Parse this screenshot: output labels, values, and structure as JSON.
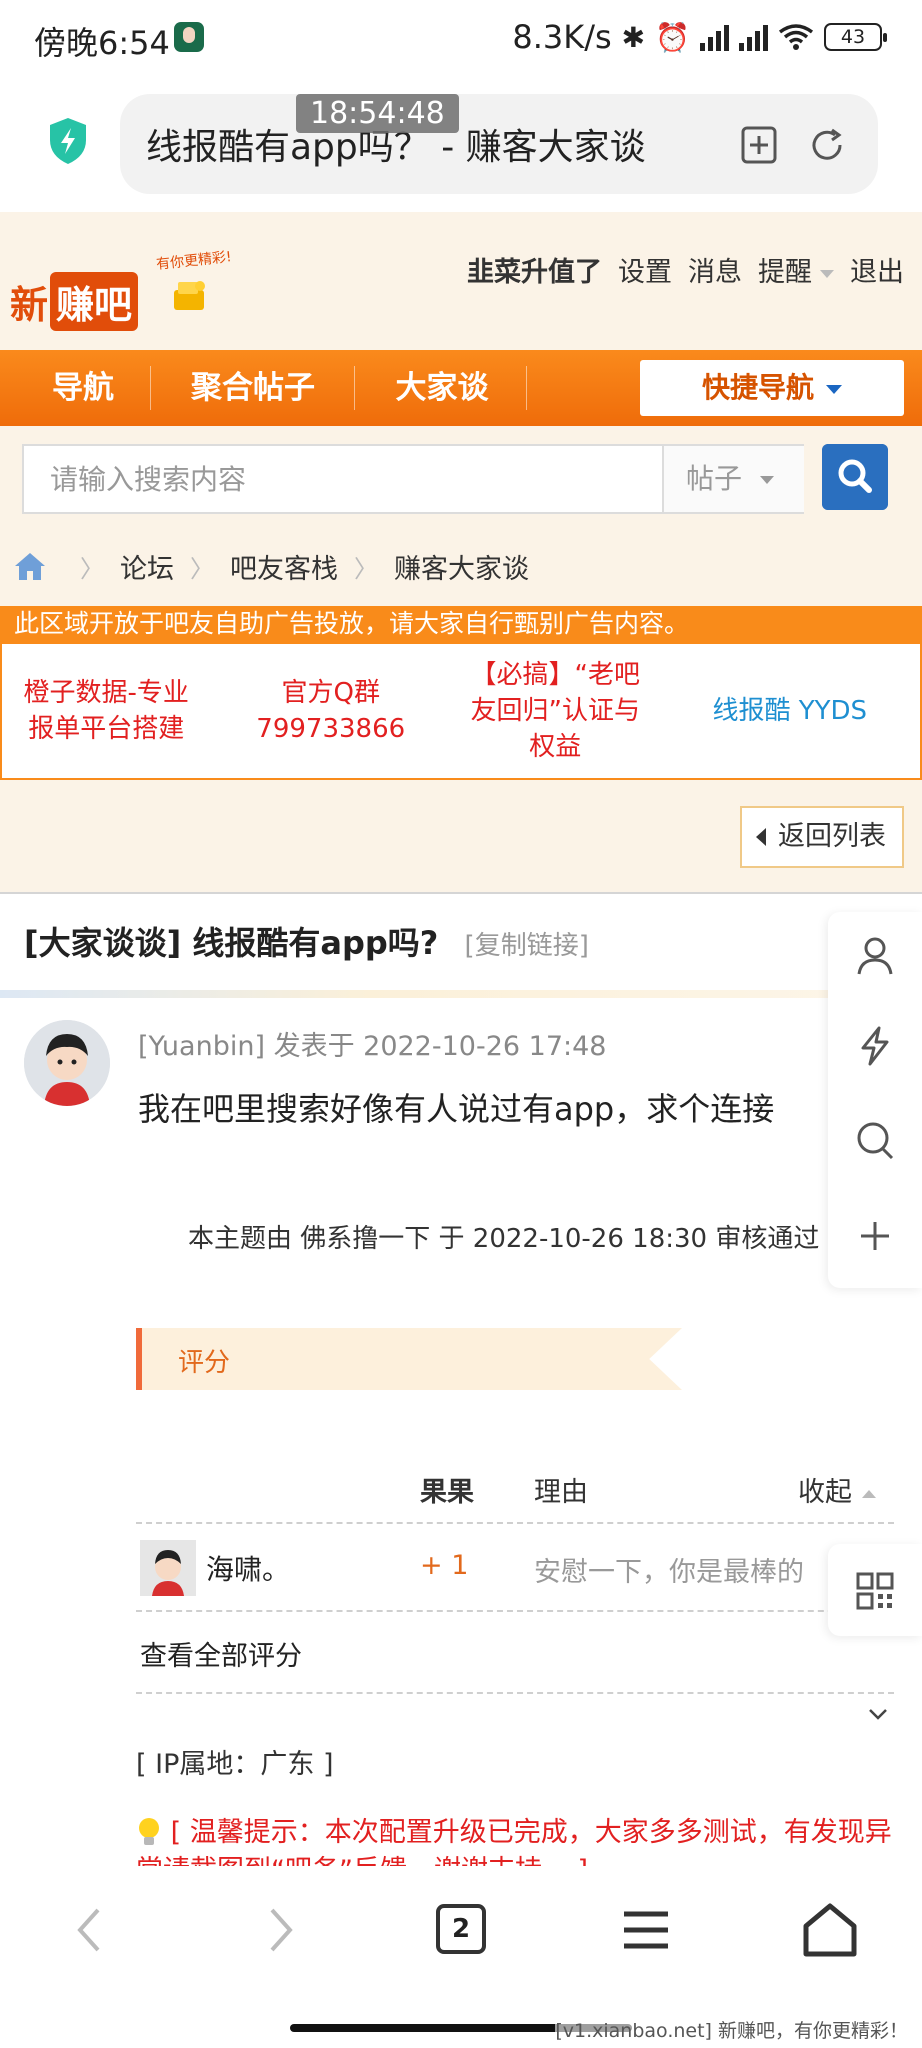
{
  "status_bar": {
    "time": "傍晚6:54",
    "net_speed": "8.3K/s",
    "battery": "43",
    "icons": [
      "bluetooth-icon",
      "alarm-icon",
      "signal-hd-icon",
      "signal-hd-icon",
      "wifi-icon",
      "battery-icon"
    ]
  },
  "browser": {
    "url_title": "线报酷有app吗？ - 赚客大家谈",
    "overlay_time": "18:54:48",
    "tab_count": "2"
  },
  "site": {
    "logo_text_1": "新",
    "logo_text_2": "赚吧",
    "logo_slogan": "有你更精彩!",
    "top_links": {
      "user": "韭菜升值了",
      "settings": "设置",
      "messages": "消息",
      "reminders": "提醒",
      "logout": "退出"
    },
    "nav": {
      "items": [
        "导航",
        "聚合帖子",
        "大家谈"
      ],
      "quick_nav": "快捷导航"
    },
    "search": {
      "placeholder": "请输入搜索内容",
      "scope": "帖子"
    },
    "breadcrumb": [
      "论坛",
      "吧友客栈",
      "赚客大家谈"
    ],
    "notice": "此区域开放于吧友自助广告投放，请大家自行甄别广告内容。",
    "ads": [
      {
        "text": "橙子数据-专业报单平台搭建",
        "color": "#e22020"
      },
      {
        "text": "官方Q群 799733866",
        "color": "#e22020"
      },
      {
        "text": "【必搞】“老吧友回归”认证与权益",
        "color": "#e22020"
      },
      {
        "text": "线报酷 YYDS",
        "color": "#1e8fd1"
      }
    ],
    "back_to_list": "返回列表"
  },
  "post": {
    "title": "[大家谈谈] 线报酷有app吗?",
    "copy_link": "[复制链接]",
    "author_meta": "[Yuanbin] 发表于 2022-10-26 17:48",
    "body": "我在吧里搜索好像有人说过有app，求个连接",
    "audit_note": "本主题由 佛系撸一下 于 2022-10-26 18:30 审核通过",
    "rating": {
      "header": "评分",
      "col_score": "果果",
      "col_reason": "理由",
      "collapse": "收起",
      "rows": [
        {
          "user": "海啸。",
          "score": "+ 1",
          "reason": "安慰一下，你是最棒的"
        }
      ],
      "view_all": "查看全部评分"
    },
    "ip_location": "[ IP属地：广东 ]",
    "tip": "[ 温馨提示：本次配置升级已完成，大家多多测试，有发现异常请截图到“吧务”反馈，谢谢支持。 ]"
  },
  "watermark": "[v1.xianbao.net] 新赚吧，有你更精彩！",
  "colors": {
    "brand_orange": "#f98b1a",
    "brand_red": "#e14d0a",
    "link_blue": "#2a6fbf"
  }
}
